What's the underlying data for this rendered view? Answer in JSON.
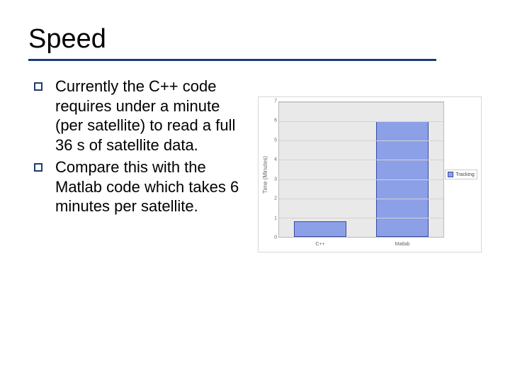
{
  "title": "Speed",
  "bullets": [
    "Currently the C++ code requires under a minute (per satellite) to read a full 36 s of satellite data.",
    "Compare this with the Matlab code which takes 6 minutes per satellite."
  ],
  "chart_data": {
    "type": "bar",
    "categories": [
      "C++",
      "Matlab"
    ],
    "values": [
      0.8,
      6
    ],
    "series": [
      {
        "name": "Tracking",
        "values": [
          0.8,
          6
        ]
      }
    ],
    "title": "",
    "xlabel": "",
    "ylabel": "Time (Minutes)",
    "ylim": [
      0,
      7
    ],
    "yticks": [
      0,
      1,
      2,
      3,
      4,
      5,
      6,
      7
    ],
    "legend": [
      "Tracking"
    ],
    "legend_position": "right",
    "grid": true
  }
}
